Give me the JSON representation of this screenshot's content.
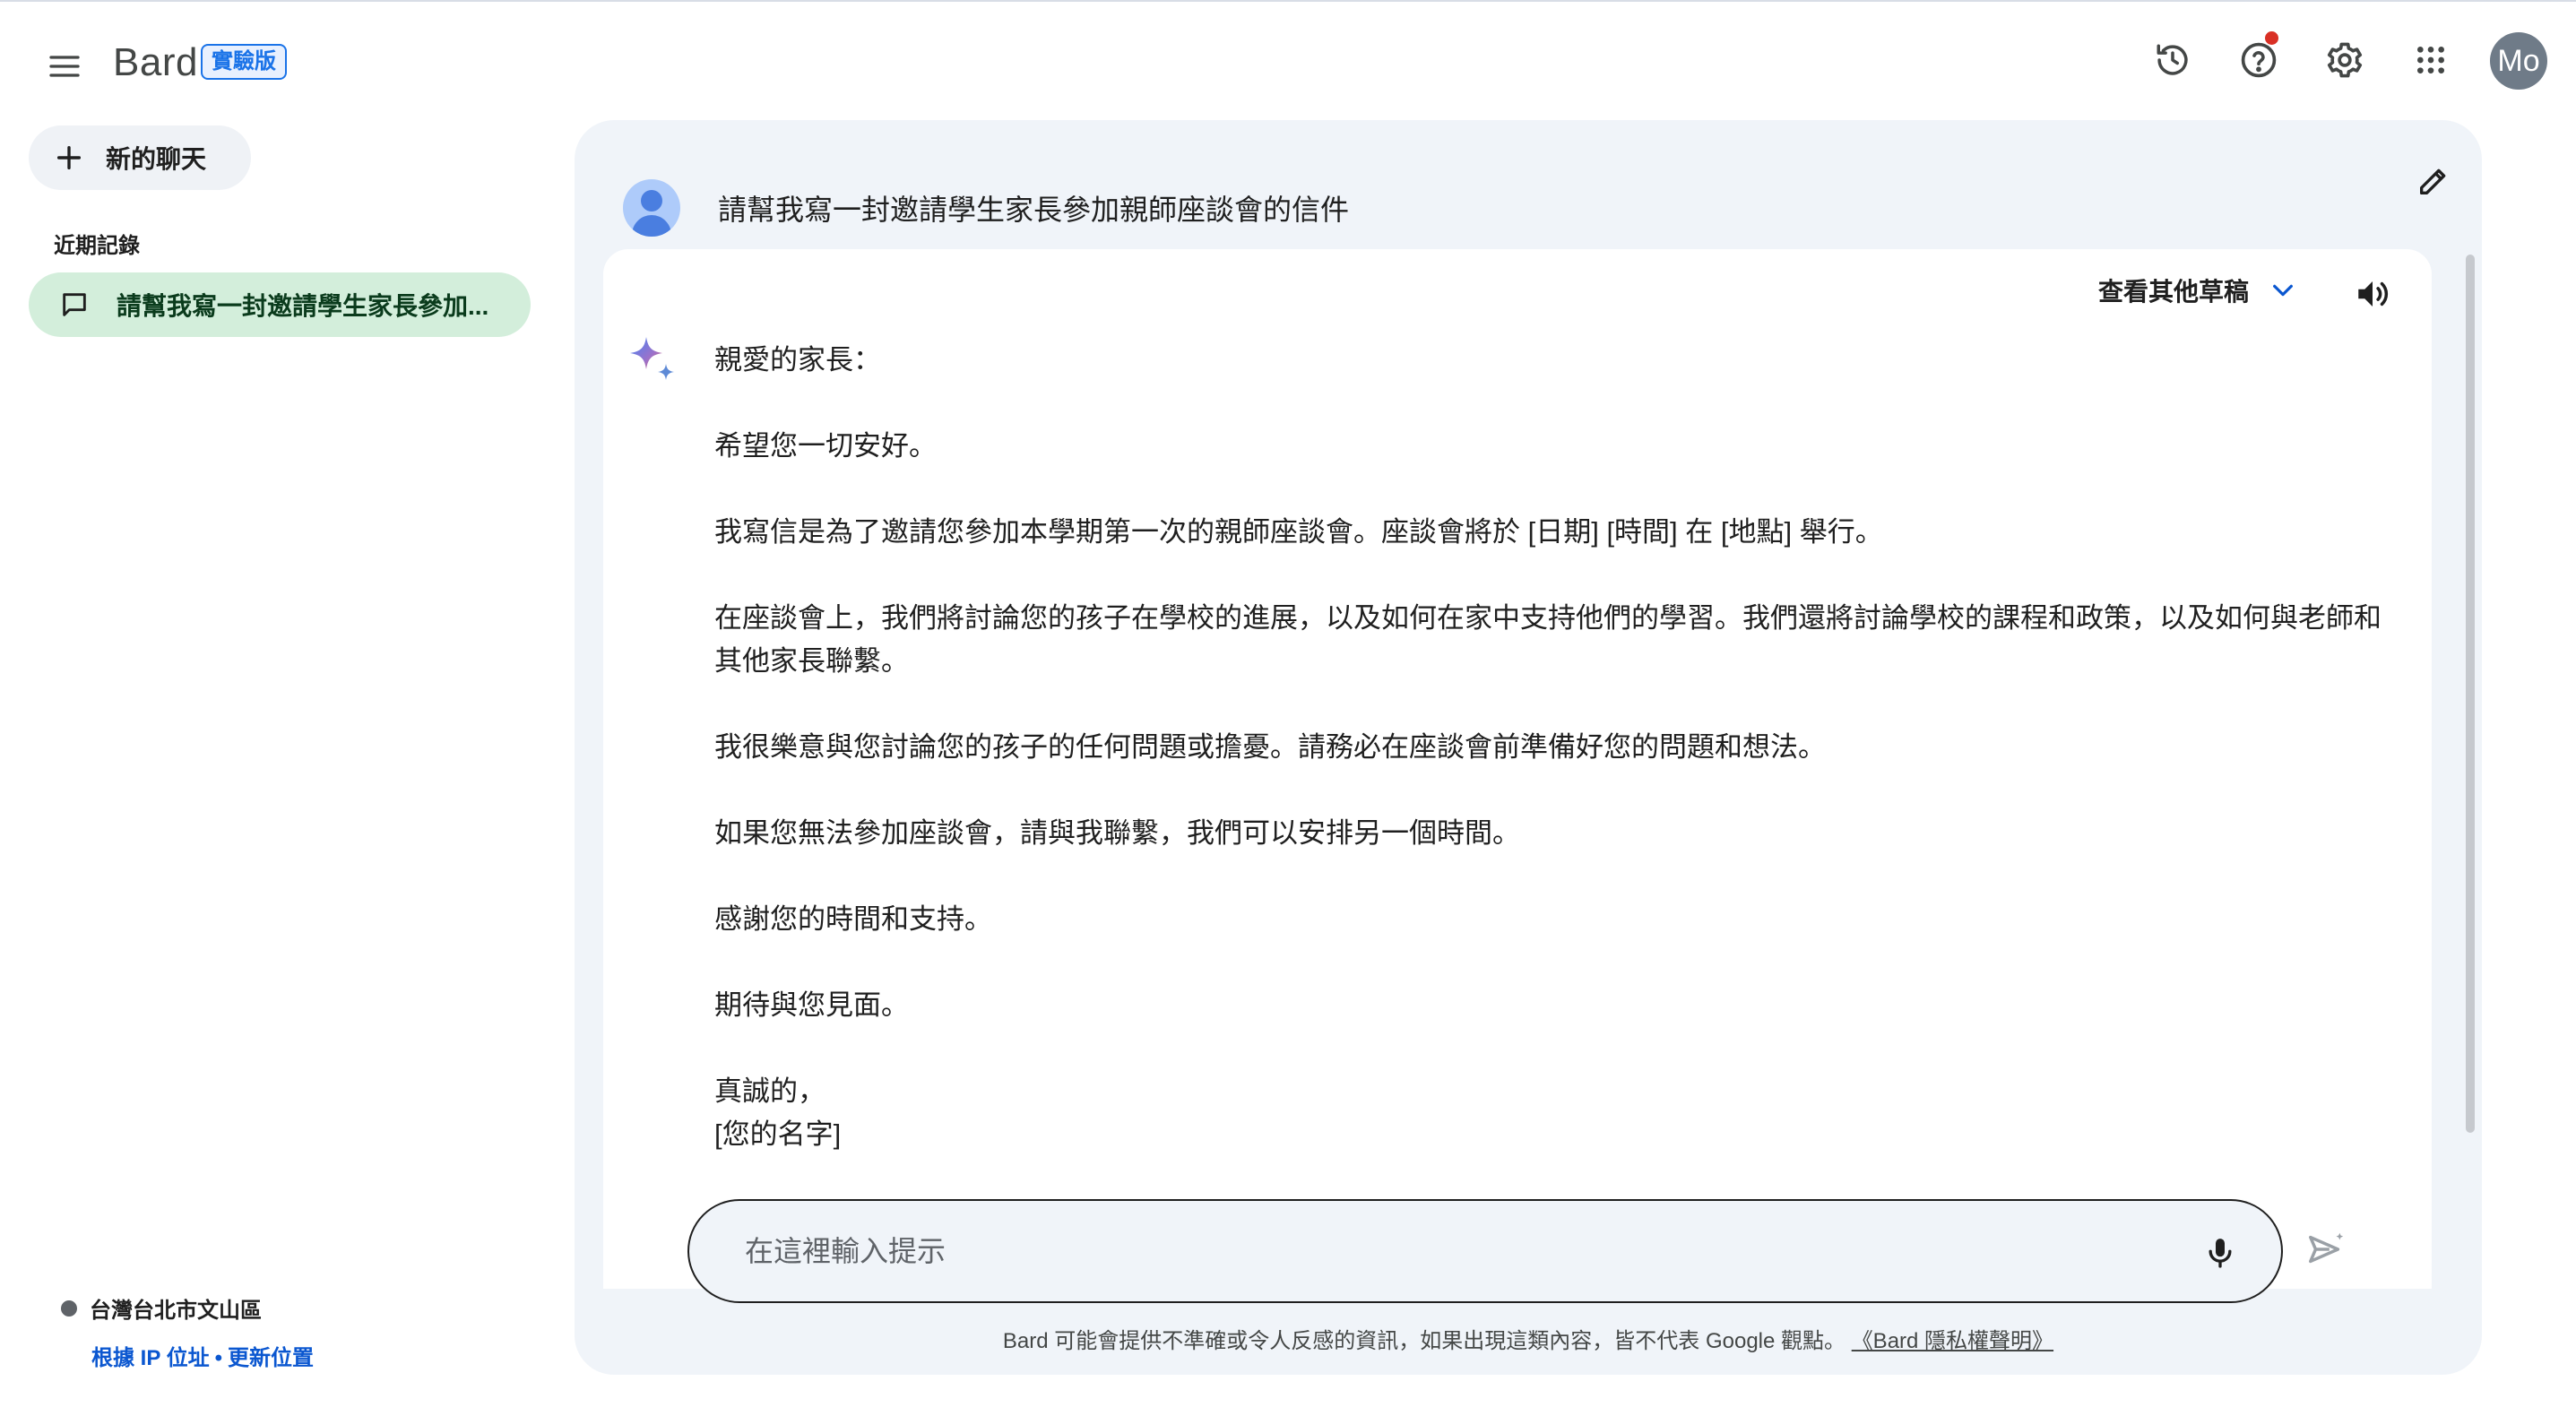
{
  "app": {
    "logo": "Bard",
    "badge": "實驗版",
    "avatar_initials": "Mo"
  },
  "topbar": {
    "icons": [
      "menu-icon",
      "history-icon",
      "help-icon",
      "settings-icon",
      "apps-grid-icon"
    ],
    "notification_color": "#d93025"
  },
  "sidebar": {
    "new_chat_label": "新的聊天",
    "recent_title": "近期記錄",
    "recent_items": [
      {
        "label": "請幫我寫一封邀請學生家長參加..."
      }
    ],
    "location": {
      "place": "台灣台北市文山區",
      "link_ip": "根據 IP 位址",
      "separator": "•",
      "link_update": "更新位置"
    }
  },
  "chat": {
    "user_prompt": "請幫我寫一封邀請學生家長參加親師座談會的信件",
    "drafts_label": "查看其他草稿",
    "response": {
      "p1": "親愛的家長：",
      "p2": "希望您一切安好。",
      "p3": "我寫信是為了邀請您參加本學期第一次的親師座談會。座談會將於 [日期] [時間] 在 [地點] 舉行。",
      "p4": "在座談會上，我們將討論您的孩子在學校的進展，以及如何在家中支持他們的學習。我們還將討論學校的課程和政策，以及如何與老師和其他家長聯繫。",
      "p5": "我很樂意與您討論您的孩子的任何問題或擔憂。請務必在座談會前準備好您的問題和想法。",
      "p6": "如果您無法參加座談會，請與我聯繫，我們可以安排另一個時間。",
      "p7": "感謝您的時間和支持。",
      "p8": "期待與您見面。",
      "p9": "真誠的，",
      "p10": "[您的名字]"
    }
  },
  "composer": {
    "placeholder": "在這裡輸入提示",
    "value": ""
  },
  "footer": {
    "disclaimer": "Bard 可能會提供不準確或令人反感的資訊，如果出現這類內容，皆不代表 Google 觀點。",
    "privacy_link": "《Bard 隱私權聲明》"
  },
  "colors": {
    "accent": "#1a73e8",
    "panel_bg": "#f0f4f9",
    "active_item_bg": "#d3eedb",
    "link": "#0b57d0"
  }
}
